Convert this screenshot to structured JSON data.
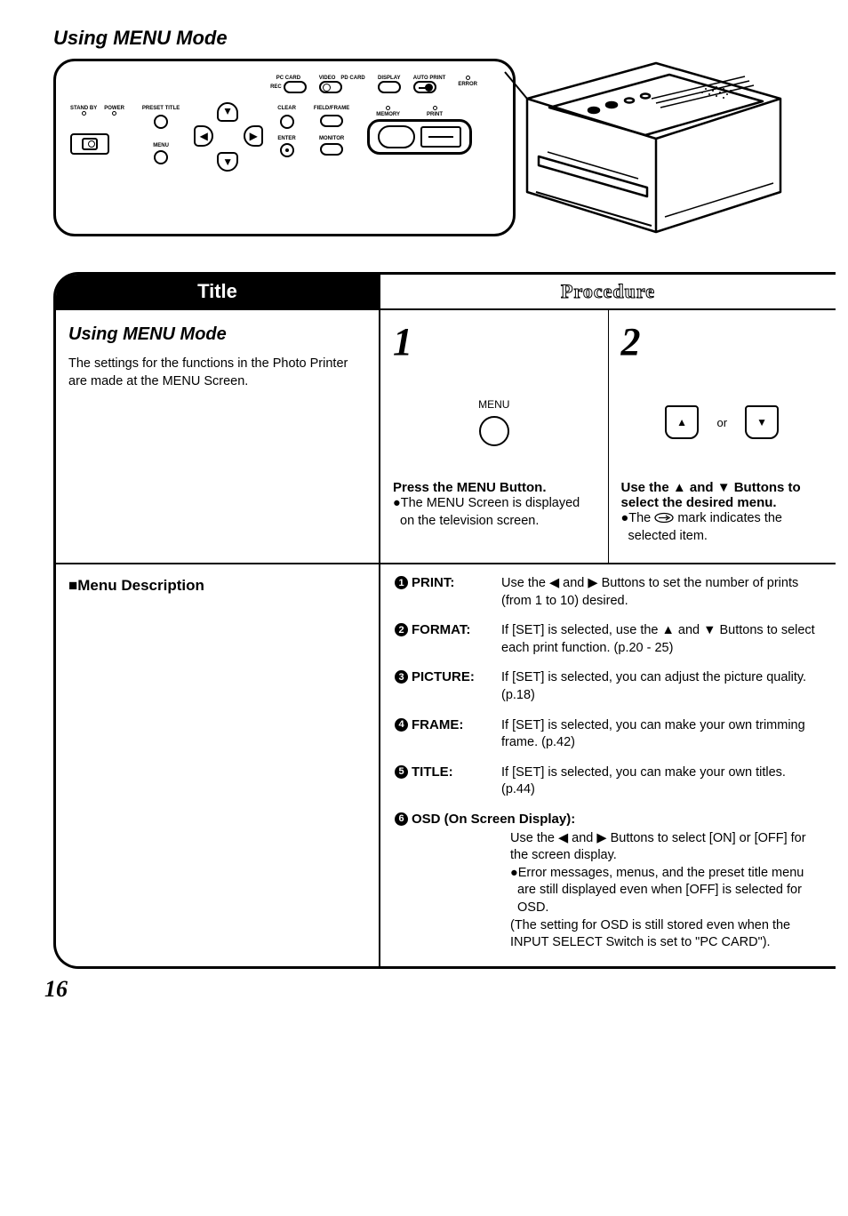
{
  "page_title": "Using MENU Mode",
  "page_number": "16",
  "panel": {
    "top_labels": [
      "PC CARD",
      "REC",
      "VIDEO",
      "PD CARD",
      "DISPLAY",
      "AUTO PRINT",
      "ERROR"
    ],
    "mid_labels": [
      "STAND BY",
      "POWER",
      "PRESET TITLE",
      "CLEAR",
      "FIELD/FRAME",
      "MEMORY",
      "PRINT"
    ],
    "bottom_labels": [
      "MENU",
      "ENTER",
      "MONITOR"
    ]
  },
  "table": {
    "title_header": "Title",
    "procedure_header": "Procedure",
    "left": {
      "subtitle": "Using MENU Mode",
      "text": "The settings for the functions in the Photo Printer are made at the MENU Screen."
    },
    "step1": {
      "num": "1",
      "icon_label": "MENU",
      "title": "Press the MENU Button.",
      "bullet": "●The MENU Screen is displayed on the television screen."
    },
    "step2": {
      "num": "2",
      "or": "or",
      "title": "Use the ▲ and ▼ Buttons to select the desired menu.",
      "bullet_prefix": "●The ",
      "bullet_suffix": " mark indicates the selected item."
    },
    "menu_desc_title": "■Menu Description",
    "items": [
      {
        "n": "1",
        "label": "PRINT:",
        "text": "Use the ◀ and ▶ Buttons to set the number of prints (from 1 to 10) desired."
      },
      {
        "n": "2",
        "label": "FORMAT:",
        "text": "If [SET] is selected, use the ▲ and ▼ Buttons to select each print function. (p.20 - 25)"
      },
      {
        "n": "3",
        "label": "PICTURE:",
        "text": "If [SET] is selected, you can adjust the picture quality. (p.18)"
      },
      {
        "n": "4",
        "label": "FRAME:",
        "text": "If [SET] is selected, you can make your own trimming frame. (p.42)"
      },
      {
        "n": "5",
        "label": "TITLE:",
        "text": "If [SET] is selected, you can make your own titles. (p.44)"
      }
    ],
    "osd": {
      "n": "6",
      "label": "OSD (On Screen Display):",
      "line1": "Use the ◀ and ▶ Buttons to select [ON] or [OFF] for the screen display.",
      "line2": "●Error messages, menus, and the preset title menu are still displayed even when [OFF] is selected for OSD.",
      "line3": "(The setting for OSD is still stored even when the INPUT SELECT Switch is set to \"PC CARD\")."
    }
  }
}
